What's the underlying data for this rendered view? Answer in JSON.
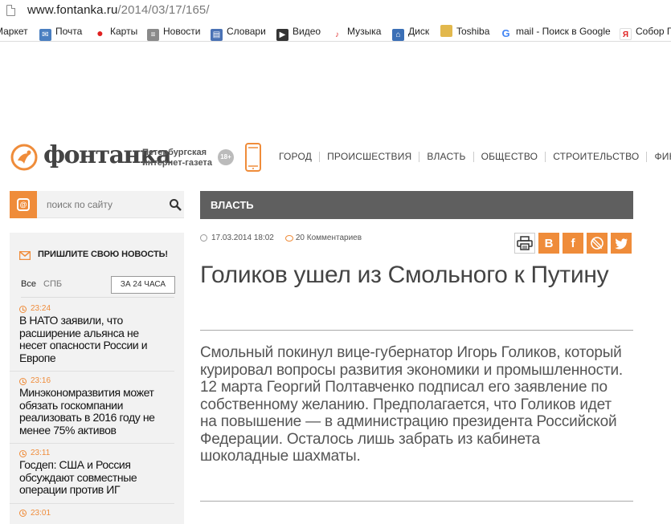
{
  "browser": {
    "url_host": "www.fontanka.ru",
    "url_path": "/2014/03/17/165/",
    "bookmarks": [
      {
        "label": "Маркет",
        "icon": "market-icon",
        "color": "#888888"
      },
      {
        "label": "Почта",
        "icon": "mail-icon",
        "color": "#4a7fc1"
      },
      {
        "label": "Карты",
        "icon": "map-pin-icon",
        "color": "#e02020"
      },
      {
        "label": "Новости",
        "icon": "news-icon",
        "color": "#8a8a8a"
      },
      {
        "label": "Словари",
        "icon": "dictionary-icon",
        "color": "#4a72b5"
      },
      {
        "label": "Видео",
        "icon": "video-icon",
        "color": "#333333"
      },
      {
        "label": "Музыка",
        "icon": "music-icon",
        "color": "#e03a3a"
      },
      {
        "label": "Диск",
        "icon": "disk-icon",
        "color": "#3b6fb6"
      },
      {
        "label": "Toshiba",
        "icon": "folder-icon",
        "color": "#e2b84d"
      },
      {
        "label": "mail - Поиск в Google",
        "icon": "google-icon",
        "color": "#4285f4"
      },
      {
        "label": "Собор Г",
        "icon": "yandex-icon",
        "color": "#e02020"
      }
    ]
  },
  "header": {
    "logo_text": "фонтанка",
    "tagline_1": "Петербургская",
    "tagline_2": "интернет-газета",
    "age_rating": "18+",
    "nav": [
      "ГОРОД",
      "ПРОИСШЕСТВИЯ",
      "ВЛАСТЬ",
      "ОБЩЕСТВО",
      "СТРОИТЕЛЬСТВО",
      "ФИНА"
    ],
    "accent_color": "#ef8c3a"
  },
  "sidebar": {
    "search_placeholder": "поиск по сайту",
    "send_news_label": "ПРИШЛИТЕ СВОЮ НОВОСТЬ!",
    "tabs": [
      "Все",
      "СПБ"
    ],
    "period_button": "ЗА 24 ЧАСА",
    "feed": [
      {
        "time": "23:24",
        "headline": "В НАТО заявили, что расширение альянса не несет опасности России и Европе"
      },
      {
        "time": "23:16",
        "headline": "Минэкономразвития может обязать госкомпании реализовать в 2016 году не менее 75% активов"
      },
      {
        "time": "23:11",
        "headline": "Госдеп: США и Россия обсуждают совместные операции против ИГ"
      },
      {
        "time": "23:01",
        "headline": ""
      }
    ]
  },
  "article": {
    "section": "ВЛАСТЬ",
    "date": "17.03.2014 18:02",
    "comments": "20 Комментариев",
    "title": "Голиков ушел из Смольного к Путину",
    "lead": "Смольный покинул вице-губернатор Игорь Голиков, который курировал вопросы развития экономики и промышленности. 12 марта Георгий Полтавченко подписал его заявление по собственному желанию. Предполагается, что Голиков идет на повышение — в администрацию президента Российской Федерации. Осталось лишь забрать из кабинета шоколадные шахматы.",
    "share": [
      {
        "name": "print",
        "label": ""
      },
      {
        "name": "vkontakte",
        "label": "В"
      },
      {
        "name": "facebook",
        "label": "f"
      },
      {
        "name": "livejournal",
        "label": ""
      },
      {
        "name": "twitter",
        "label": ""
      }
    ]
  }
}
